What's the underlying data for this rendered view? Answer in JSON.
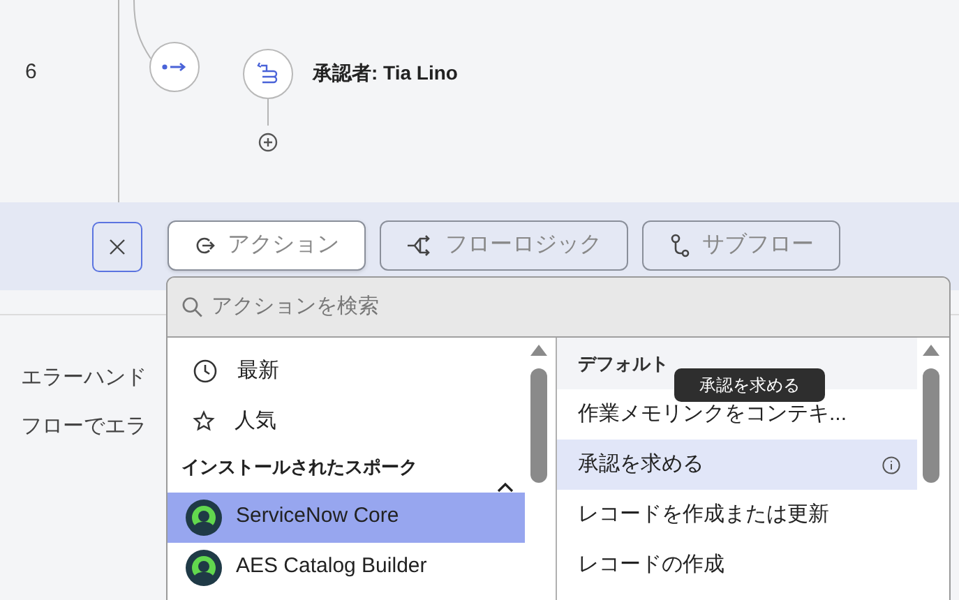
{
  "flow": {
    "line_number": "6",
    "step_label": "承認者: Tia Lino"
  },
  "toolbar": {
    "tabs": [
      {
        "label": "アクション",
        "kind": "action",
        "selected": true
      },
      {
        "label": "フローロジック",
        "kind": "logic",
        "selected": false
      },
      {
        "label": "サブフロー",
        "kind": "subflow",
        "selected": false
      }
    ]
  },
  "background_text": [
    "エラーハンド",
    "フローでエラ"
  ],
  "picker": {
    "search": {
      "placeholder": "アクションを検索"
    },
    "categories": [
      {
        "label": "最新",
        "kind": "recent"
      },
      {
        "label": "人気",
        "kind": "popular"
      }
    ],
    "section": {
      "title": "インストールされたスポーク",
      "expanded": true
    },
    "spokes": [
      {
        "label": "ServiceNow Core",
        "selected": true
      },
      {
        "label": "AES Catalog Builder",
        "selected": false
      }
    ],
    "group_title": "デフォルト",
    "actions": [
      {
        "label": "作業メモリンクをコンテキ...",
        "selected": false
      },
      {
        "label": "承認を求める",
        "selected": true
      },
      {
        "label": "レコードを作成または更新",
        "selected": false
      },
      {
        "label": "レコードの作成",
        "selected": false
      }
    ],
    "tooltip": "承認を求める"
  }
}
